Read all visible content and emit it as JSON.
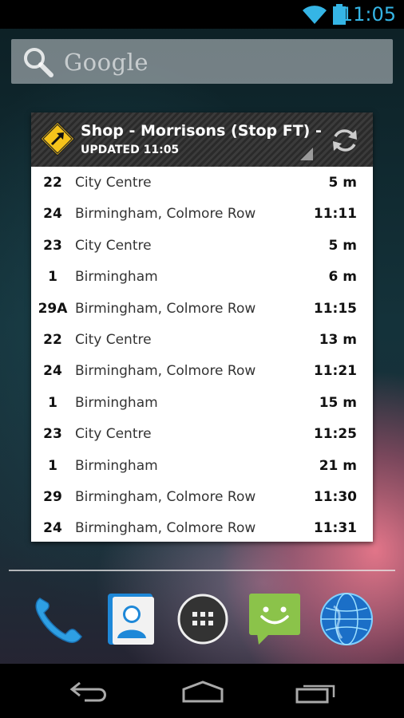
{
  "status_bar": {
    "time": "11:05",
    "icons": [
      "wifi-icon",
      "battery-icon"
    ],
    "accent_color": "#35b5e5"
  },
  "search": {
    "logo_text": "Google",
    "icon": "search-icon"
  },
  "widget": {
    "stop_title": "Shop - Morrisons  (Stop FT) -",
    "updated": "UPDATED 11:05",
    "stop_icon": "bus-stop-sign-icon",
    "refresh_icon": "refresh-icon",
    "departures": [
      {
        "route": "22",
        "destination": "City Centre",
        "eta": "5 m"
      },
      {
        "route": "24",
        "destination": "Birmingham, Colmore Row",
        "eta": "11:11"
      },
      {
        "route": "23",
        "destination": "City Centre",
        "eta": "5 m"
      },
      {
        "route": "1",
        "destination": "Birmingham",
        "eta": "6 m"
      },
      {
        "route": "29A",
        "destination": "Birmingham, Colmore Row",
        "eta": "11:15"
      },
      {
        "route": "22",
        "destination": "City Centre",
        "eta": "13 m"
      },
      {
        "route": "24",
        "destination": "Birmingham, Colmore Row",
        "eta": "11:21"
      },
      {
        "route": "1",
        "destination": "Birmingham",
        "eta": "15 m"
      },
      {
        "route": "23",
        "destination": "City Centre",
        "eta": "11:25"
      },
      {
        "route": "1",
        "destination": "Birmingham",
        "eta": "21 m"
      },
      {
        "route": "29",
        "destination": "Birmingham, Colmore Row",
        "eta": "11:30"
      },
      {
        "route": "24",
        "destination": "Birmingham, Colmore Row",
        "eta": "11:31"
      }
    ]
  },
  "dock": {
    "apps": [
      "phone-icon",
      "contacts-icon",
      "app-drawer-icon",
      "messaging-icon",
      "browser-icon"
    ]
  },
  "nav_bar": {
    "buttons": [
      "back-icon",
      "home-icon",
      "recents-icon"
    ]
  }
}
